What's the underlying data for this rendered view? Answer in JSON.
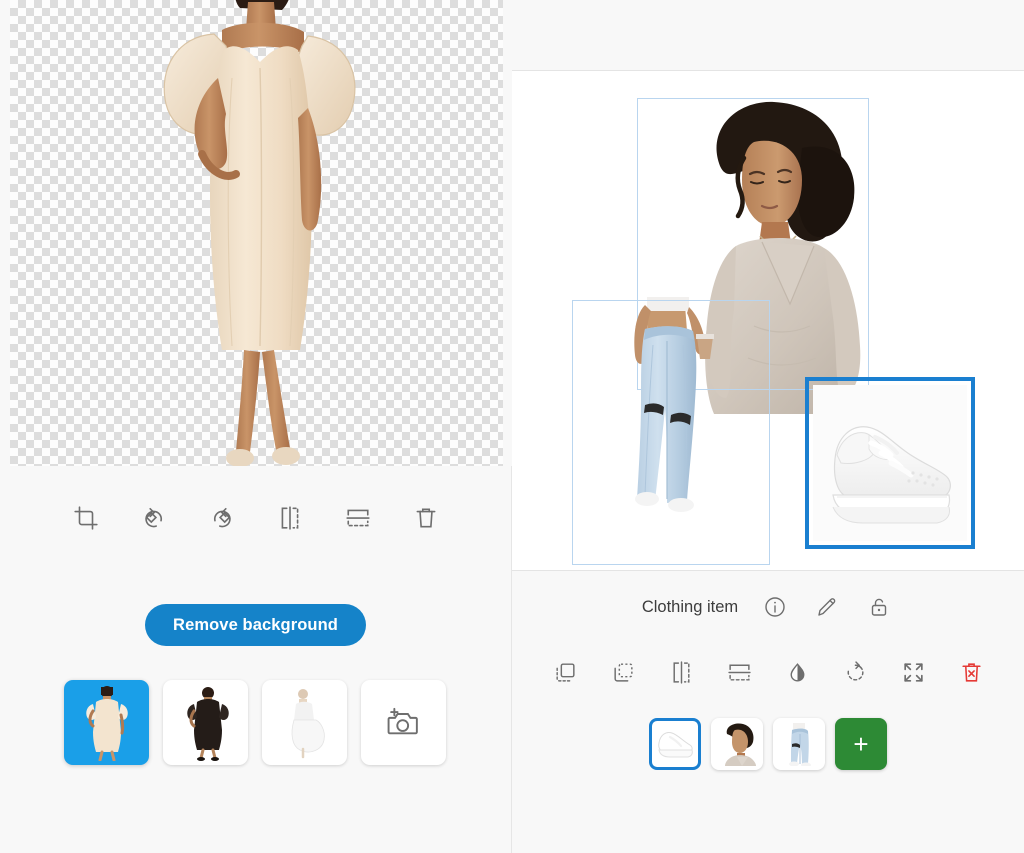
{
  "left_panel": {
    "canvas": {
      "background": "transparent-checkerboard",
      "subject_name": "cream-off-shoulder-dress-model"
    },
    "toolbar": {
      "items": [
        {
          "name": "crop-icon",
          "label": "Crop"
        },
        {
          "name": "rotate-left-icon",
          "label": "Rotate left"
        },
        {
          "name": "rotate-right-icon",
          "label": "Rotate right"
        },
        {
          "name": "flip-horizontal-icon",
          "label": "Flip horizontal"
        },
        {
          "name": "flip-vertical-icon",
          "label": "Flip vertical"
        },
        {
          "name": "trash-icon",
          "label": "Delete"
        }
      ]
    },
    "primary_action": {
      "label": "Remove background",
      "color": "#1583c9",
      "text_color": "#ffffff"
    },
    "thumbnails": {
      "selected_index": 0,
      "selected_color": "#1a9fe8",
      "items": [
        {
          "name": "thumbnail-cream-dress",
          "kind": "image",
          "selected": true
        },
        {
          "name": "thumbnail-black-dress",
          "kind": "image",
          "selected": false
        },
        {
          "name": "thumbnail-white-dress",
          "kind": "image",
          "selected": false
        },
        {
          "name": "add-photo-icon",
          "kind": "add",
          "selected": false
        }
      ]
    }
  },
  "right_panel": {
    "header": {
      "title": ""
    },
    "canvas": {
      "layers": [
        {
          "name": "layer-sweater-model",
          "selected": false,
          "selection_color": "#b9d5ef"
        },
        {
          "name": "layer-jeans-model",
          "selected": false,
          "selection_color": "#b9d5ef"
        },
        {
          "name": "layer-white-sneaker",
          "selected": true,
          "selection_color": "#1a7fd0"
        }
      ]
    },
    "object_label": {
      "text": "Clothing item",
      "actions": [
        {
          "name": "info-icon",
          "label": "Info"
        },
        {
          "name": "pencil-edit-icon",
          "label": "Edit"
        },
        {
          "name": "unlock-icon",
          "label": "Unlock"
        }
      ]
    },
    "object_tools": [
      {
        "name": "bring-to-front-icon",
        "label": "Bring to front",
        "color": "#6e6e6e"
      },
      {
        "name": "send-to-back-icon",
        "label": "Send to back",
        "color": "#6e6e6e"
      },
      {
        "name": "flip-horizontal-icon",
        "label": "Flip horizontal",
        "color": "#6e6e6e"
      },
      {
        "name": "flip-vertical-icon",
        "label": "Flip vertical",
        "color": "#6e6e6e"
      },
      {
        "name": "opacity-droplet-icon",
        "label": "Opacity",
        "color": "#6e6e6e"
      },
      {
        "name": "rotate-icon",
        "label": "Rotate",
        "color": "#6e6e6e"
      },
      {
        "name": "expand-fullscreen-icon",
        "label": "Resize",
        "color": "#6e6e6e"
      },
      {
        "name": "delete-red-icon",
        "label": "Delete",
        "color": "#e53935"
      }
    ],
    "thumbnails": {
      "selected_index": 0,
      "selected_color": "#1a7fd0",
      "add_color": "#2d8a35",
      "items": [
        {
          "name": "thumbnail-white-sneaker",
          "kind": "image",
          "selected": true
        },
        {
          "name": "thumbnail-sweater-model",
          "kind": "image",
          "selected": false
        },
        {
          "name": "thumbnail-jeans-model",
          "kind": "image",
          "selected": false
        },
        {
          "name": "add-item-button",
          "kind": "add",
          "label": "+",
          "selected": false
        }
      ]
    }
  }
}
